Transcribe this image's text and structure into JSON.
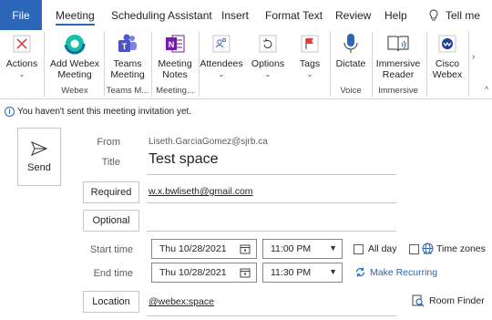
{
  "tabs": {
    "file": "File",
    "items": [
      "Meeting",
      "Scheduling Assistant",
      "Insert",
      "Format Text",
      "Review",
      "Help"
    ],
    "tell_me": "Tell me"
  },
  "ribbon": {
    "actions": "Actions",
    "add_webex_1": "Add Webex",
    "add_webex_2": "Meeting",
    "teams_1": "Teams",
    "teams_2": "Meeting",
    "notes_1": "Meeting",
    "notes_2": "Notes",
    "attendees": "Attendees",
    "options": "Options",
    "tags": "Tags",
    "dictate": "Dictate",
    "immersive_1": "Immersive",
    "immersive_2": "Reader",
    "cisco_1": "Cisco",
    "cisco_2": "Webex",
    "groups": {
      "webex": "Webex",
      "teams": "Teams M...",
      "notes": "Meeting...",
      "voice": "Voice",
      "immersive": "Immersive"
    }
  },
  "info_bar": "You haven't sent this meeting invitation yet.",
  "send": "Send",
  "form": {
    "from_label": "From",
    "from_value": "Liseth.GarciaGomez@sjrb.ca",
    "title_label": "Title",
    "title_value": "Test space",
    "required_label": "Required",
    "required_value": "w.x.bwliseth@gmail.com",
    "optional_label": "Optional",
    "optional_value": "",
    "start_label": "Start time",
    "start_date": "Thu 10/28/2021",
    "start_time": "11:00 PM",
    "end_label": "End time",
    "end_date": "Thu 10/28/2021",
    "end_time": "11:30 PM",
    "all_day": "All day",
    "time_zones": "Time zones",
    "make_recurring": "Make Recurring",
    "location_label": "Location",
    "location_value": "@webex:space",
    "room_finder": "Room Finder"
  },
  "colors": {
    "accent": "#2b66b8",
    "tags_flag": "#e03c3c",
    "webex_teal": "#06a36b"
  }
}
